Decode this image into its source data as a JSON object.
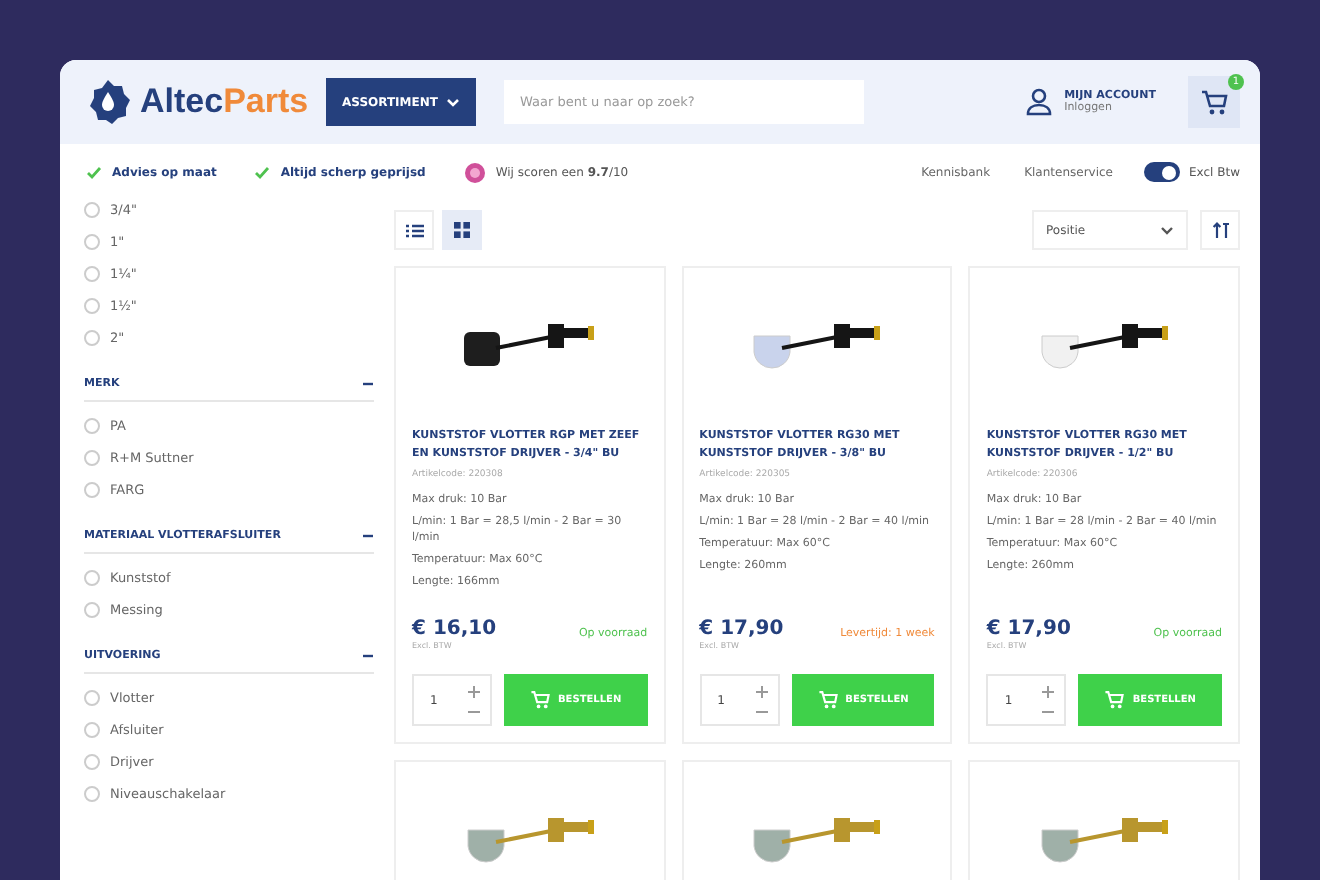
{
  "header": {
    "logo": {
      "first": "Altec",
      "second": "Parts"
    },
    "menu_button": "ASSORTIMENT",
    "search": {
      "placeholder": "Waar bent u naar op zoek?"
    },
    "account": {
      "title": "MIJN ACCOUNT",
      "subtitle": "Inloggen"
    },
    "cart": {
      "count": "1"
    }
  },
  "usp_bar": {
    "usps": [
      {
        "text": "Advies op maat"
      },
      {
        "text": "Altijd scherp geprijsd"
      }
    ],
    "rating": "Wij scoren een **9.7**/10",
    "links": [
      "Kennisbank",
      "Klantenservice"
    ],
    "vat_toggle": {
      "label": "Excl Btw",
      "on": true
    }
  },
  "filters": [
    {
      "options": [
        {
          "label": "3/4\"",
          "checked": false
        },
        {
          "label": "1\"",
          "checked": false
        },
        {
          "label": "1¼\"",
          "checked": false
        },
        {
          "label": "1½\"",
          "checked": false
        },
        {
          "label": "2\"",
          "checked": false
        }
      ]
    },
    {
      "title": "MERK",
      "expanded": true,
      "options": [
        {
          "label": "PA",
          "checked": false
        },
        {
          "label": "R+M Suttner",
          "checked": false
        },
        {
          "label": "FARG",
          "checked": false
        }
      ]
    },
    {
      "title": "MATERIAAL VLOTTERAFSLUITER",
      "expanded": true,
      "options": [
        {
          "label": "Kunststof",
          "checked": false
        },
        {
          "label": "Messing",
          "checked": false
        }
      ]
    },
    {
      "title": "UITVOERING",
      "expanded": true,
      "options": [
        {
          "label": "Vlotter",
          "checked": false
        },
        {
          "label": "Afsluiter",
          "checked": false
        },
        {
          "label": "Drijver",
          "checked": false
        },
        {
          "label": "Niveauschakelaar",
          "checked": false
        }
      ]
    }
  ],
  "toolbar": {
    "views": [
      {
        "kind": "list",
        "selected": false
      },
      {
        "kind": "grid",
        "selected": true
      }
    ],
    "sort": "Positie"
  },
  "products": [
    {
      "kind": "black",
      "title": "KUNSTSTOF VLOTTER RGP MET ZEEF EN KUNSTSTOF DRIJVER - 3/4\" BU",
      "code": "Artikelcode: 220308",
      "specs": [
        "Max druk: 10 Bar",
        "L/min: 1 Bar = 28,5 l/min - 2 Bar = 30 l/min",
        "Temperatuur: Max 60°C",
        "Lengte: 166mm"
      ],
      "price": "€ 16,10",
      "price_note": "Excl. BTW",
      "stock": {
        "kind": "in_stock",
        "text": "Op voorraad"
      },
      "quantity": "1",
      "button": "BESTELLEN"
    },
    {
      "kind": "blue",
      "title": "KUNSTSTOF VLOTTER RG30 MET KUNSTSTOF DRIJVER - 3/8\" BU",
      "code": "Artikelcode: 220305",
      "specs": [
        "Max druk: 10 Bar",
        "L/min: 1 Bar = 28 l/min - 2 Bar = 40 l/min",
        "Temperatuur: Max 60°C",
        "Lengte: 260mm"
      ],
      "price": "€ 17,90",
      "price_note": "Excl. BTW",
      "stock": {
        "kind": "lead_time",
        "text": "Levertijd: 1 week"
      },
      "quantity": "1",
      "button": "BESTELLEN"
    },
    {
      "kind": "white",
      "title": "KUNSTSTOF VLOTTER RG30 MET KUNSTSTOF DRIJVER - 1/2\" BU",
      "code": "Artikelcode: 220306",
      "specs": [
        "Max druk: 10 Bar",
        "L/min: 1 Bar = 28 l/min - 2 Bar = 40 l/min",
        "Temperatuur: Max 60°C",
        "Lengte: 260mm"
      ],
      "price": "€ 17,90",
      "price_note": "Excl. BTW",
      "stock": {
        "kind": "in_stock",
        "text": "Op voorraad"
      },
      "quantity": "1",
      "button": "BESTELLEN"
    },
    {
      "kind": "brass"
    },
    {
      "kind": "brass"
    },
    {
      "kind": "brass"
    }
  ]
}
